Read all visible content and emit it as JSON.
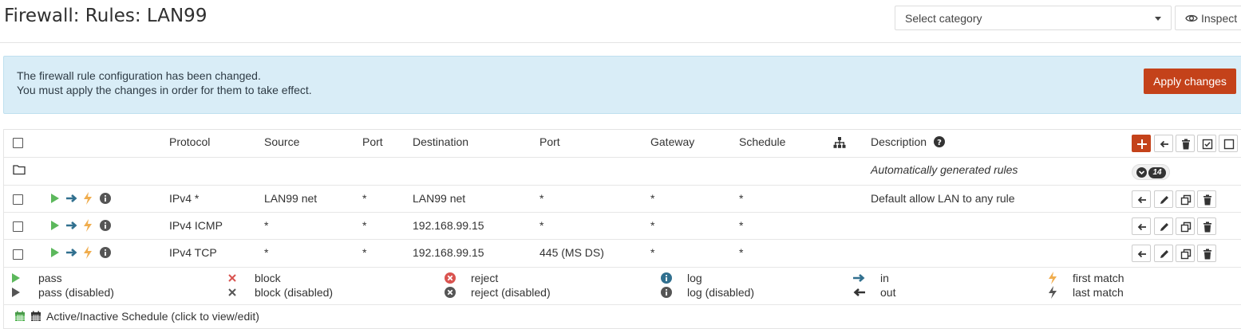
{
  "header": {
    "title": "Firewall: Rules: LAN99",
    "category_select": "Select category",
    "inspect_label": "Inspect"
  },
  "alert": {
    "line1": "The firewall rule configuration has been changed.",
    "line2": "You must apply the changes in order for them to take effect.",
    "apply_label": "Apply changes"
  },
  "table": {
    "columns": {
      "protocol": "Protocol",
      "source": "Source",
      "port": "Port",
      "destination": "Destination",
      "dest_port": "Port",
      "gateway": "Gateway",
      "schedule": "Schedule",
      "description": "Description"
    },
    "auto_group": {
      "label": "Automatically generated rules",
      "count": "14"
    },
    "rules": [
      {
        "protocol": "IPv4 *",
        "source": "LAN99 net",
        "port": "*",
        "destination": "LAN99 net",
        "dest_port": "*",
        "gateway": "*",
        "schedule": "*",
        "description": "Default allow LAN to any rule"
      },
      {
        "protocol": "IPv4 ICMP",
        "source": "*",
        "port": "*",
        "destination": "192.168.99.15",
        "dest_port": "*",
        "gateway": "*",
        "schedule": "*",
        "description": ""
      },
      {
        "protocol": "IPv4 TCP",
        "source": "*",
        "port": "*",
        "destination": "192.168.99.15",
        "dest_port": "445 (MS DS)",
        "gateway": "*",
        "schedule": "*",
        "description": ""
      }
    ]
  },
  "legend": {
    "pass": "pass",
    "pass_disabled": "pass (disabled)",
    "block": "block",
    "block_disabled": "block (disabled)",
    "reject": "reject",
    "reject_disabled": "reject (disabled)",
    "log": "log",
    "log_disabled": "log (disabled)",
    "in": "in",
    "out": "out",
    "first_match": "first match",
    "last_match": "last match",
    "schedule": "Active/Inactive Schedule (click to view/edit)"
  },
  "colors": {
    "accent": "#c4421a",
    "pass": "#5cb85c",
    "block": "#d9534f",
    "log": "#31708f",
    "direction": "#31708f",
    "quick": "#f0ad4e",
    "alert_bg": "#d9edf7"
  }
}
